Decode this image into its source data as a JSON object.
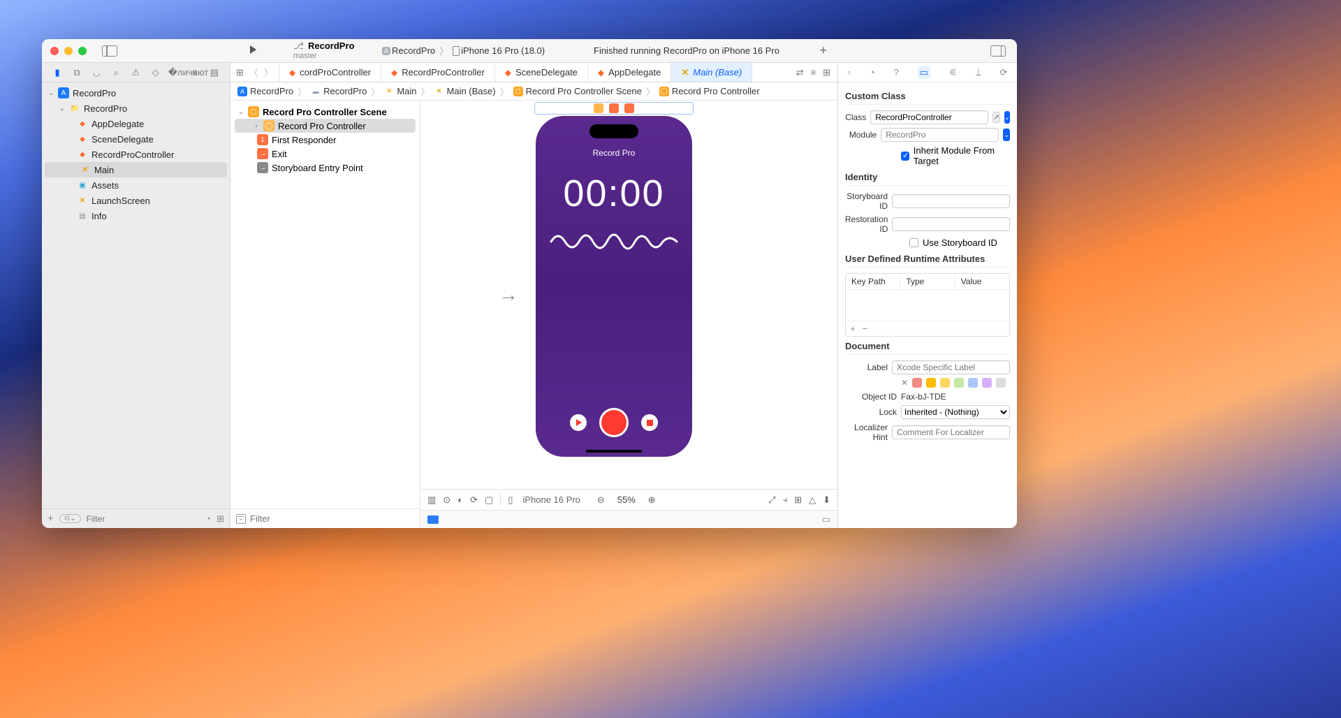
{
  "titlebar": {
    "app_title": "RecordPro",
    "branch": "master",
    "scheme_app": "RecordPro",
    "scheme_device": "iPhone 16 Pro (18.0)",
    "status": "Finished running RecordPro on iPhone 16 Pro"
  },
  "navigator": {
    "root": "RecordPro",
    "folder": "RecordPro",
    "items": [
      {
        "label": "AppDelegate",
        "kind": "swift"
      },
      {
        "label": "SceneDelegate",
        "kind": "swift"
      },
      {
        "label": "RecordProController",
        "kind": "swift"
      },
      {
        "label": "Main",
        "kind": "xib",
        "selected": true
      },
      {
        "label": "Assets",
        "kind": "assets"
      },
      {
        "label": "LaunchScreen",
        "kind": "xib"
      },
      {
        "label": "Info",
        "kind": "plist"
      }
    ],
    "filter_placeholder": "Filter"
  },
  "editor_tabs": [
    {
      "label": "cordProController",
      "icon": "swift"
    },
    {
      "label": "RecordProController",
      "icon": "swift"
    },
    {
      "label": "SceneDelegate",
      "icon": "swift"
    },
    {
      "label": "AppDelegate",
      "icon": "swift"
    },
    {
      "label": "Main (Base)",
      "icon": "xib",
      "active": true
    }
  ],
  "crumbs": [
    {
      "label": "RecordPro",
      "icon": "app"
    },
    {
      "label": "RecordPro",
      "icon": "folder"
    },
    {
      "label": "Main",
      "icon": "xib"
    },
    {
      "label": "Main (Base)",
      "icon": "xib"
    },
    {
      "label": "Record Pro Controller Scene",
      "icon": "sb"
    },
    {
      "label": "Record Pro Controller",
      "icon": "sb"
    }
  ],
  "outline": {
    "scene": "Record Pro Controller Scene",
    "items": [
      {
        "label": "Record Pro Controller",
        "icon": "vc",
        "selected": true,
        "indent": 1,
        "disclosure": true
      },
      {
        "label": "First Responder",
        "icon": "fr",
        "indent": 1
      },
      {
        "label": "Exit",
        "icon": "exit",
        "indent": 1
      },
      {
        "label": "Storyboard Entry Point",
        "icon": "ep",
        "indent": 1
      }
    ],
    "filter_placeholder": "Filter"
  },
  "canvas": {
    "title": "Record Pro",
    "timer": "00:00",
    "device": "iPhone 16 Pro",
    "zoom": "55%"
  },
  "inspector": {
    "custom_class": {
      "header": "Custom Class",
      "class_label": "Class",
      "class_value": "RecordProController",
      "module_label": "Module",
      "module_value": "RecordPro",
      "inherit_label": "Inherit Module From Target"
    },
    "identity": {
      "header": "Identity",
      "storyboard_id_label": "Storyboard ID",
      "restoration_id_label": "Restoration ID",
      "use_sbid_label": "Use Storyboard ID"
    },
    "runtime": {
      "header": "User Defined Runtime Attributes",
      "cols": [
        "Key Path",
        "Type",
        "Value"
      ]
    },
    "document": {
      "header": "Document",
      "label_label": "Label",
      "label_placeholder": "Xcode Specific Label",
      "object_id_label": "Object ID",
      "object_id_value": "Fax-bJ-TDE",
      "lock_label": "Lock",
      "lock_value": "Inherited - (Nothing)",
      "loc_label": "Localizer Hint",
      "loc_placeholder": "Comment For Localizer",
      "swatches": [
        "#f28b82",
        "#fbbc04",
        "#fdd663",
        "#c6e7a5",
        "#a7c7fa",
        "#d7aefb",
        "#dadce0"
      ]
    }
  }
}
